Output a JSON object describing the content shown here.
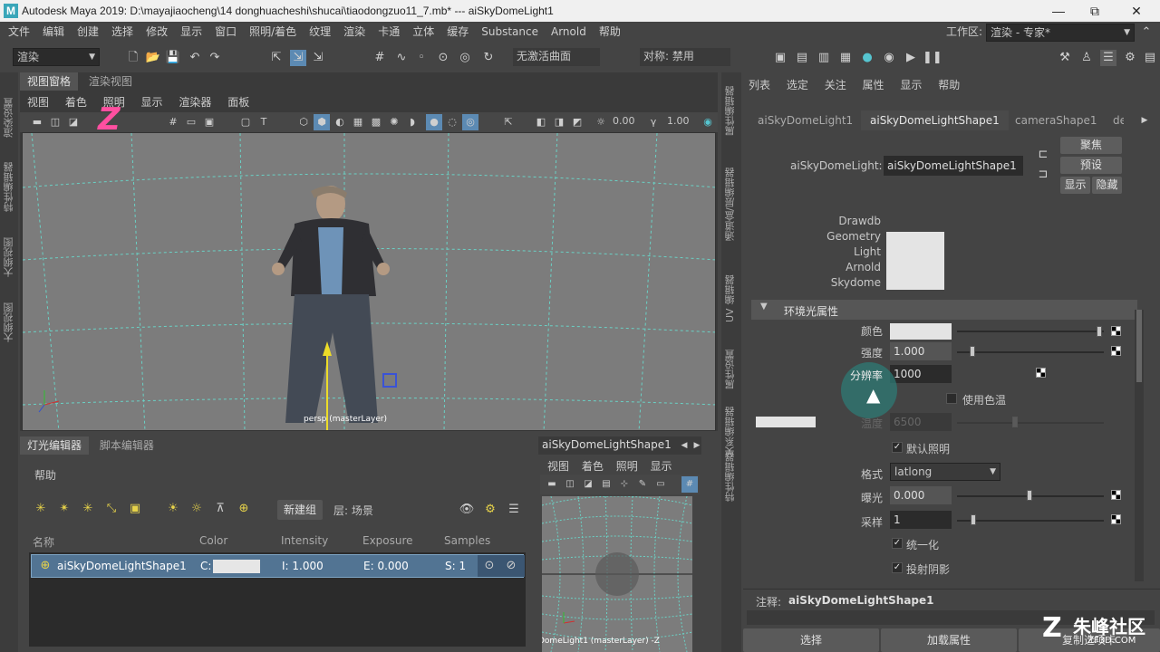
{
  "window": {
    "logo": "M",
    "title": "Autodesk Maya 2019: D:\\mayajiaocheng\\14 donghuacheshi\\shucai\\tiaodongzuo11_7.mb*   ---   aiSkyDomeLight1",
    "minimize": "—",
    "restore": "⧉",
    "close": "✕"
  },
  "menubar": {
    "items": [
      "文件",
      "编辑",
      "创建",
      "选择",
      "修改",
      "显示",
      "窗口",
      "照明/着色",
      "纹理",
      "渲染",
      "卡通",
      "立体",
      "缓存",
      "Substance",
      "Arnold",
      "帮助"
    ],
    "workspace_label": "工作区:",
    "workspace_value": "渲染 - 专家*"
  },
  "toolbar": {
    "mode_dropdown": "渲染",
    "live_surface": "无激活曲面",
    "symmetry": "对称: 禁用"
  },
  "left_sidebar": {
    "tabs": [
      "渲染设置",
      "特性编辑器",
      "大纲视图",
      "大纲视图"
    ]
  },
  "viewport": {
    "tabs": [
      "视图窗格",
      "渲染视图"
    ],
    "menu": [
      "视图",
      "着色",
      "照明",
      "显示",
      "渲染器",
      "面板"
    ],
    "field1": "0.00",
    "field2": "1.00",
    "camera_label": "persp (masterLayer)"
  },
  "light_editor": {
    "tabs": [
      "灯光编辑器",
      "脚本编辑器"
    ],
    "help": "帮助",
    "new_group": "新建组",
    "layer": "层: 场景",
    "columns": [
      "名称",
      "Color",
      "Intensity",
      "Exposure",
      "Samples"
    ],
    "row": {
      "name": "aiSkyDomeLightShape1",
      "color_prefix": "C:",
      "intensity": "I: 1.000",
      "exposure": "E: 0.000",
      "samples": "S: 1"
    }
  },
  "mini_view": {
    "title": "aiSkyDomeLightShape1",
    "menu": [
      "视图",
      "着色",
      "照明",
      "显示"
    ],
    "camera_label": "DomeLight1 (masterLayer) -Z"
  },
  "right_strip": {
    "tabs": [
      "属性编辑器",
      "通道盒/层编辑器",
      "UV 编辑器",
      "属性设置",
      "关系编辑器",
      "特性编辑器"
    ]
  },
  "attribute_editor": {
    "menu": [
      "列表",
      "选定",
      "关注",
      "属性",
      "显示",
      "帮助"
    ],
    "tabs": [
      "aiSkyDomeLight1",
      "aiSkyDomeLightShape1",
      "cameraShape1",
      "de"
    ],
    "node_label": "aiSkyDomeLight:",
    "node_value": "aiSkyDomeLightShape1",
    "buttons": {
      "focus": "聚焦",
      "presets": "预设",
      "show": "显示",
      "hide": "隐藏"
    },
    "classification": [
      "Drawdb",
      "Geometry",
      "Light",
      "Arnold",
      "Skydome"
    ],
    "section_title": "环境光属性",
    "attrs": {
      "color_label": "颜色",
      "intensity_label": "强度",
      "intensity_value": "1.000",
      "resolution_label": "分辨率",
      "resolution_value": "1000",
      "use_temp_label": "使用色温",
      "temperature_label": "温度",
      "temperature_value": "6500",
      "default_lighting_label": "默认照明",
      "format_label": "格式",
      "format_value": "latlong",
      "exposure_label": "曝光",
      "exposure_value": "0.000",
      "samples_label": "采样",
      "samples_value": "1",
      "normalize_label": "统一化",
      "cast_shadows_label": "投射阴影"
    },
    "notes_label": "注释:",
    "notes_value": "aiSkyDomeLightShape1",
    "bottom_buttons": [
      "选择",
      "加载属性",
      "复制选项卡"
    ]
  },
  "watermark": {
    "text": "朱峰社区",
    "sub": "ZF3D.COM"
  }
}
